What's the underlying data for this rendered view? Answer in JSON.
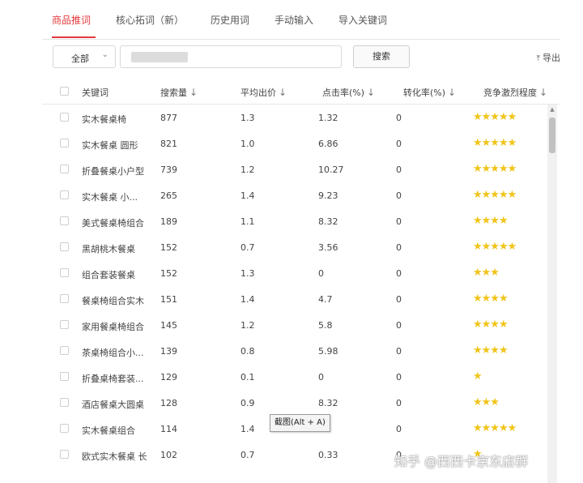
{
  "tabs": [
    {
      "label": "商品推词",
      "active": true
    },
    {
      "label": "核心拓词（新）",
      "active": false
    },
    {
      "label": "历史用词",
      "active": false
    },
    {
      "label": "手动输入",
      "active": false
    },
    {
      "label": "导入关键词",
      "active": false
    }
  ],
  "filter": {
    "selected": "全部",
    "chevron": "⌄",
    "search_value": "",
    "search_label": "搜索"
  },
  "export_label": "导出",
  "columns": [
    {
      "label": "关键词",
      "sortable": false
    },
    {
      "label": "搜索量",
      "sortable": true
    },
    {
      "label": "平均出价",
      "sortable": true
    },
    {
      "label": "点击率(%)",
      "sortable": true
    },
    {
      "label": "转化率(%)",
      "sortable": true
    },
    {
      "label": "竞争激烈程度",
      "sortable": true
    }
  ],
  "sort_arrow": "↓",
  "rows": [
    {
      "keyword": "实木餐桌椅",
      "volume": "877",
      "bid": "1.3",
      "ctr": "1.32",
      "cvr": "0",
      "stars": 5
    },
    {
      "keyword": "实木餐桌 圆形",
      "volume": "821",
      "bid": "1.0",
      "ctr": "6.86",
      "cvr": "0",
      "stars": 5
    },
    {
      "keyword": "折叠餐桌小户型",
      "volume": "739",
      "bid": "1.2",
      "ctr": "10.27",
      "cvr": "0",
      "stars": 5
    },
    {
      "keyword": "实木餐桌 小...",
      "volume": "265",
      "bid": "1.4",
      "ctr": "9.23",
      "cvr": "0",
      "stars": 5
    },
    {
      "keyword": "美式餐桌椅组合",
      "volume": "189",
      "bid": "1.1",
      "ctr": "8.32",
      "cvr": "0",
      "stars": 4
    },
    {
      "keyword": "黑胡桃木餐桌",
      "volume": "152",
      "bid": "0.7",
      "ctr": "3.56",
      "cvr": "0",
      "stars": 5
    },
    {
      "keyword": "组合套装餐桌",
      "volume": "152",
      "bid": "1.3",
      "ctr": "0",
      "cvr": "0",
      "stars": 3
    },
    {
      "keyword": "餐桌椅组合实木",
      "volume": "151",
      "bid": "1.4",
      "ctr": "4.7",
      "cvr": "0",
      "stars": 4
    },
    {
      "keyword": "家用餐桌椅组合",
      "volume": "145",
      "bid": "1.2",
      "ctr": "5.8",
      "cvr": "0",
      "stars": 4
    },
    {
      "keyword": "茶桌椅组合小...",
      "volume": "139",
      "bid": "0.8",
      "ctr": "5.98",
      "cvr": "0",
      "stars": 4
    },
    {
      "keyword": "折叠桌椅套装...",
      "volume": "129",
      "bid": "0.1",
      "ctr": "0",
      "cvr": "0",
      "stars": 1
    },
    {
      "keyword": "酒店餐桌大圆桌",
      "volume": "128",
      "bid": "0.9",
      "ctr": "8.32",
      "cvr": "0",
      "stars": 3
    },
    {
      "keyword": "实木餐桌组合",
      "volume": "114",
      "bid": "1.4",
      "ctr": "",
      "cvr": "0",
      "stars": 5
    },
    {
      "keyword": "欧式实木餐桌 长",
      "volume": "102",
      "bid": "0.7",
      "ctr": "0.33",
      "cvr": "0",
      "stars": 1
    }
  ],
  "tooltip": "截图(Alt + A)",
  "watermark": "知乎 @西西卡京东店群",
  "colors": {
    "accent": "#e4393c",
    "star": "#f0c419"
  }
}
